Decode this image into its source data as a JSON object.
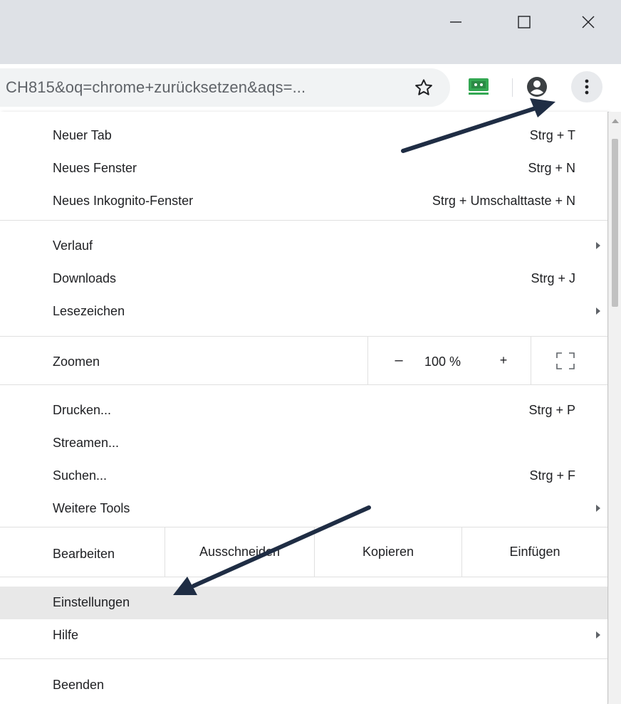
{
  "window": {
    "minimize_icon": "minimize-icon",
    "maximize_icon": "maximize-icon",
    "close_icon": "close-icon"
  },
  "toolbar": {
    "url_text": "CH815&oq=chrome+zurücksetzen&aqs=...",
    "icons": [
      "star-icon",
      "extension-icon",
      "profile-icon",
      "more-menu-icon"
    ],
    "extension_color": "#34a853"
  },
  "menu": {
    "group1": [
      {
        "label": "Neuer Tab",
        "shortcut": "Strg + T"
      },
      {
        "label": "Neues Fenster",
        "shortcut": "Strg + N"
      },
      {
        "label": "Neues Inkognito-Fenster",
        "shortcut": "Strg + Umschalttaste + N"
      }
    ],
    "group2": [
      {
        "label": "Verlauf",
        "shortcut": ""
      },
      {
        "label": "Downloads",
        "shortcut": "Strg + J"
      },
      {
        "label": "Lesezeichen",
        "shortcut": ""
      }
    ],
    "zoom": {
      "label": "Zoomen",
      "minus": "–",
      "value": "100 %",
      "plus": "+"
    },
    "group3": [
      {
        "label": "Drucken...",
        "shortcut": "Strg + P"
      },
      {
        "label": "Streamen...",
        "shortcut": ""
      },
      {
        "label": "Suchen...",
        "shortcut": "Strg + F"
      },
      {
        "label": "Weitere Tools",
        "shortcut": ""
      }
    ],
    "edit": {
      "label": "Bearbeiten",
      "cut": "Ausschneiden",
      "copy": "Kopieren",
      "paste": "Einfügen"
    },
    "settings": "Einstellungen",
    "help": "Hilfe",
    "quit": "Beenden",
    "highlight_color": "#e8e8e8"
  },
  "annotations": {
    "arrow_color": "#1f2d44",
    "arrow_icon": "annotation-arrow"
  }
}
